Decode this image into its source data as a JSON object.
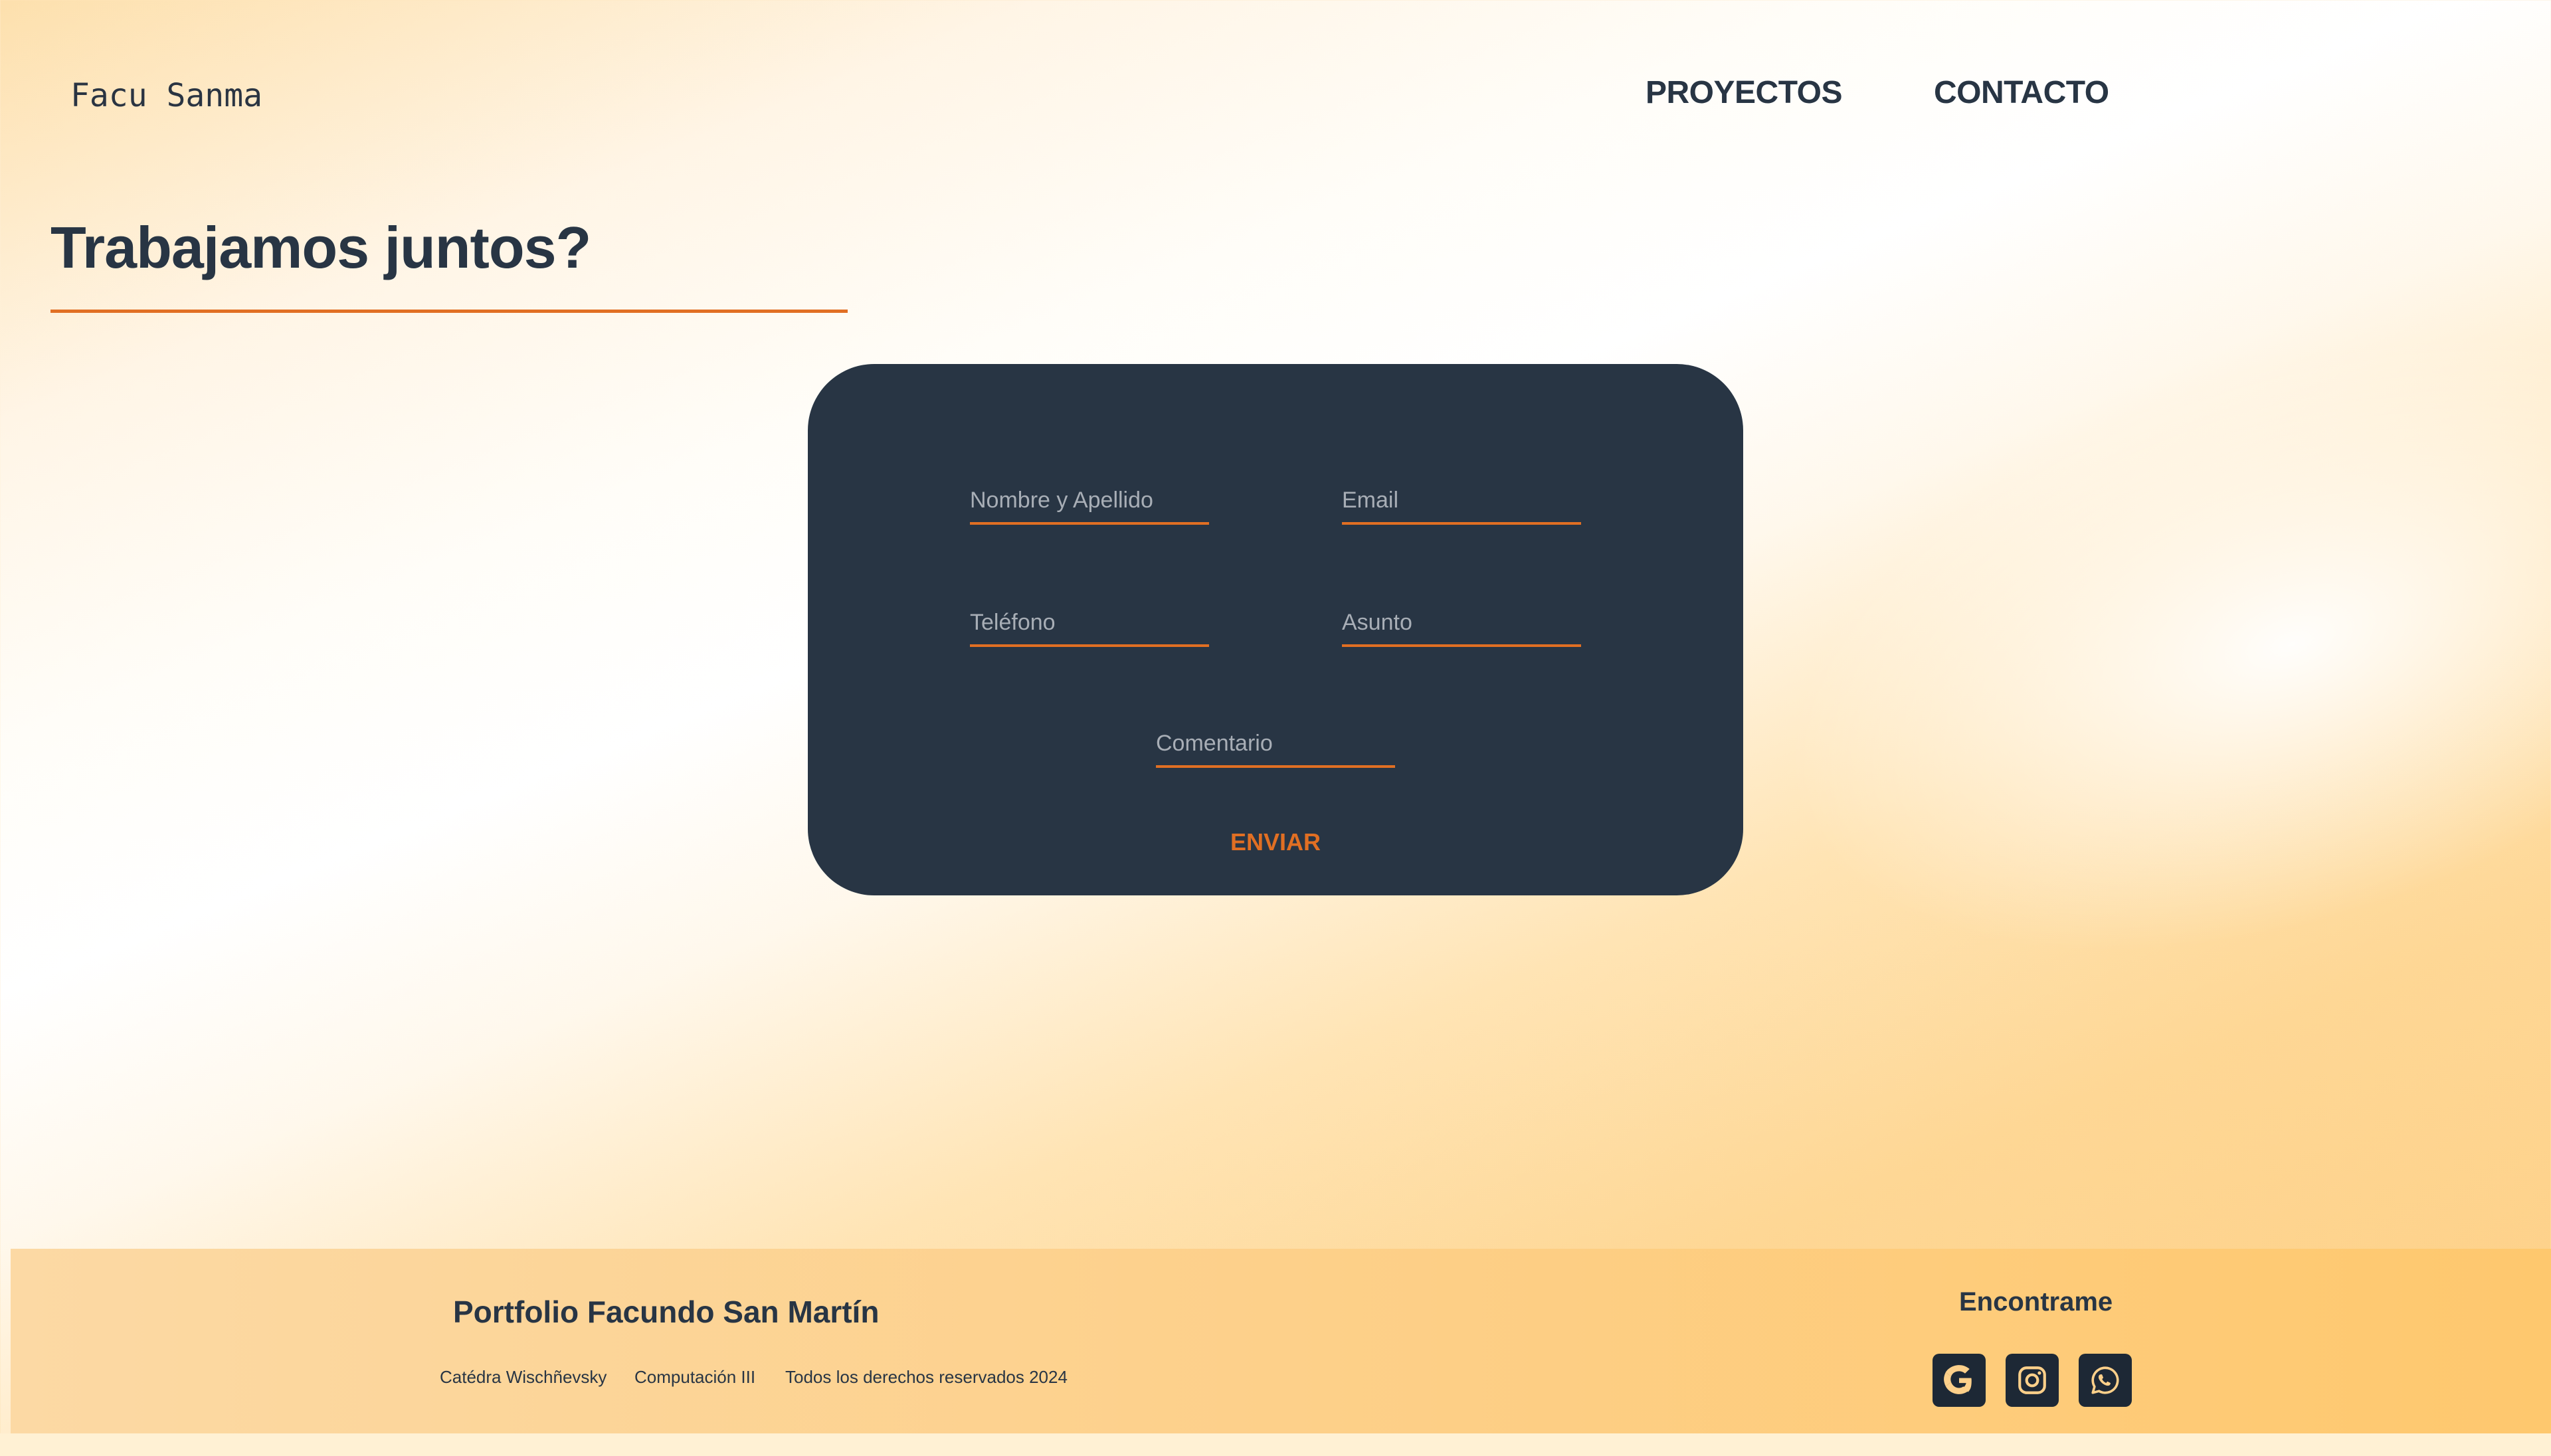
{
  "header": {
    "brand": "Facu Sanma",
    "nav": [
      {
        "label": "PROYECTOS"
      },
      {
        "label": "CONTACTO"
      }
    ]
  },
  "main": {
    "title": "Trabajamos juntos?"
  },
  "form": {
    "name_placeholder": "Nombre y Apellido",
    "email_placeholder": "Email",
    "phone_placeholder": "Teléfono",
    "subject_placeholder": "Asunto",
    "comment_placeholder": "Comentario",
    "submit_label": "ENVIAR"
  },
  "footer": {
    "title": "Portfolio Facundo San Martín",
    "meta": [
      "Catédra Wischñevsky",
      "Computación III",
      "Todos los derechos reservados 2024"
    ],
    "find_title": "Encontrame",
    "social": [
      {
        "icon": "google-icon"
      },
      {
        "icon": "instagram-icon"
      },
      {
        "icon": "whatsapp-icon"
      }
    ]
  },
  "colors": {
    "accent": "#e16f23",
    "dark": "#283544",
    "icon_fill": "#fdd08a"
  }
}
